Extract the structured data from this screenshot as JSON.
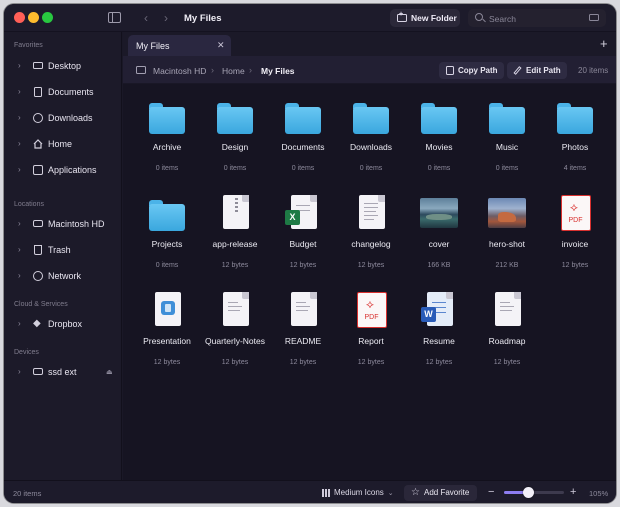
{
  "window": {
    "title": "My Files",
    "new_folder_label": "New Folder",
    "search_placeholder": "Search"
  },
  "sidebar": {
    "sections": [
      {
        "label": "Favorites",
        "items": [
          {
            "label": "Desktop",
            "icon": "desktop-icon"
          },
          {
            "label": "Documents",
            "icon": "document-icon"
          },
          {
            "label": "Downloads",
            "icon": "download-icon"
          },
          {
            "label": "Home",
            "icon": "home-icon"
          },
          {
            "label": "Applications",
            "icon": "applications-icon"
          }
        ]
      },
      {
        "label": "Locations",
        "items": [
          {
            "label": "Macintosh HD",
            "icon": "disk-icon"
          },
          {
            "label": "Trash",
            "icon": "trash-icon"
          },
          {
            "label": "Network",
            "icon": "globe-icon"
          }
        ]
      },
      {
        "label": "Cloud & Services",
        "items": [
          {
            "label": "Dropbox",
            "icon": "dropbox-icon"
          }
        ]
      },
      {
        "label": "Devices",
        "items": [
          {
            "label": "ssd ext",
            "icon": "external-drive-icon",
            "eject": "eject-icon"
          }
        ]
      }
    ]
  },
  "tabs": [
    {
      "label": "My Files"
    }
  ],
  "pathbar": {
    "crumbs": [
      "Macintosh HD",
      "Home",
      "My Files"
    ],
    "copy_path_label": "Copy Path",
    "edit_path_label": "Edit Path",
    "item_count": "20 items"
  },
  "files": [
    {
      "name": "Archive",
      "meta": "0 items",
      "kind": "folder"
    },
    {
      "name": "Design",
      "meta": "0 items",
      "kind": "folder"
    },
    {
      "name": "Documents",
      "meta": "0 items",
      "kind": "folder"
    },
    {
      "name": "Downloads",
      "meta": "0 items",
      "kind": "folder"
    },
    {
      "name": "Movies",
      "meta": "0 items",
      "kind": "folder"
    },
    {
      "name": "Music",
      "meta": "0 items",
      "kind": "folder"
    },
    {
      "name": "Photos",
      "meta": "4 items",
      "kind": "folder"
    },
    {
      "name": "Projects",
      "meta": "0 items",
      "kind": "folder"
    },
    {
      "name": "app-release",
      "meta": "12 bytes",
      "kind": "zip"
    },
    {
      "name": "Budget",
      "meta": "12 bytes",
      "kind": "excel"
    },
    {
      "name": "changelog",
      "meta": "12 bytes",
      "kind": "text"
    },
    {
      "name": "cover",
      "meta": "166 KB",
      "kind": "image-cover"
    },
    {
      "name": "hero-shot",
      "meta": "212 KB",
      "kind": "image-hero"
    },
    {
      "name": "invoice",
      "meta": "12 bytes",
      "kind": "pdf"
    },
    {
      "name": "Presentation",
      "meta": "12 bytes",
      "kind": "keynote"
    },
    {
      "name": "Quarterly-Notes",
      "meta": "12 bytes",
      "kind": "doc"
    },
    {
      "name": "README",
      "meta": "12 bytes",
      "kind": "doc"
    },
    {
      "name": "Report",
      "meta": "12 bytes",
      "kind": "pdf"
    },
    {
      "name": "Resume",
      "meta": "12 bytes",
      "kind": "word"
    },
    {
      "name": "Roadmap",
      "meta": "12 bytes",
      "kind": "doc"
    }
  ],
  "icon_text": {
    "pdf": "PDF",
    "excel": "X",
    "word": "W"
  },
  "statusbar": {
    "count": "20 items",
    "view_mode": "Medium Icons",
    "add_favorite_label": "Add Favorite",
    "zoom_fraction": 0.4,
    "zoom_level": "105%"
  },
  "colors": {
    "accent": "#8d7df0",
    "folder": "#4bb3e8",
    "pdf": "#d9312f",
    "excel": "#1e7a45",
    "word": "#2a5cb8"
  }
}
